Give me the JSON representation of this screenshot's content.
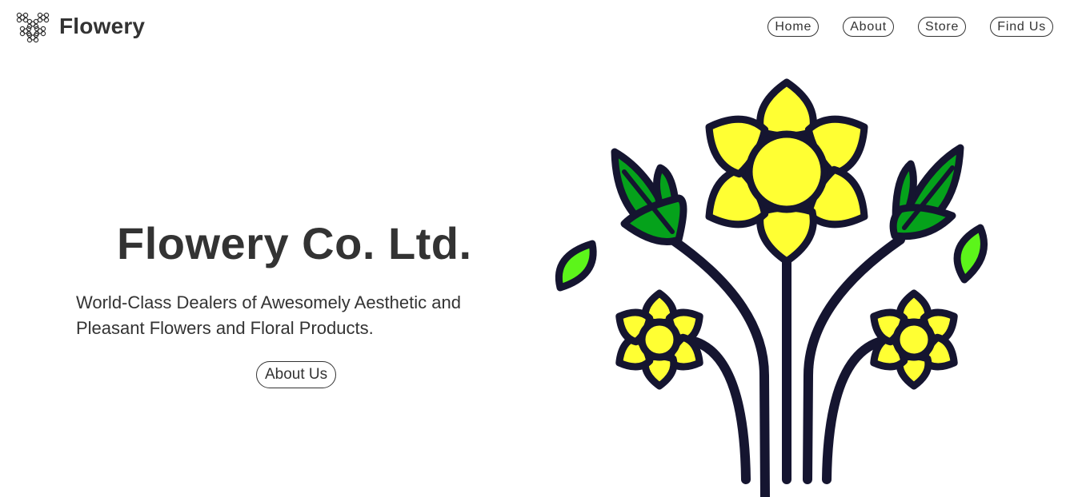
{
  "header": {
    "brand": "Flowery",
    "logo_icon": "flower-cluster-icon"
  },
  "nav": {
    "items": [
      {
        "label": "Home"
      },
      {
        "label": "About"
      },
      {
        "label": "Store"
      },
      {
        "label": "Find Us"
      }
    ]
  },
  "hero": {
    "title": "Flowery Co. Ltd.",
    "subtitle": "World-Class Dealers of Awesomely Aesthetic and Pleasant Flowers and Floral Products.",
    "cta_label": "About Us"
  },
  "illustration": {
    "icon": "flower-bouquet-illustration",
    "colors": {
      "outline": "#151530",
      "petal": "#ffff33",
      "leaf_dark": "#05a21b",
      "leaf_light": "#5cf51a"
    }
  }
}
